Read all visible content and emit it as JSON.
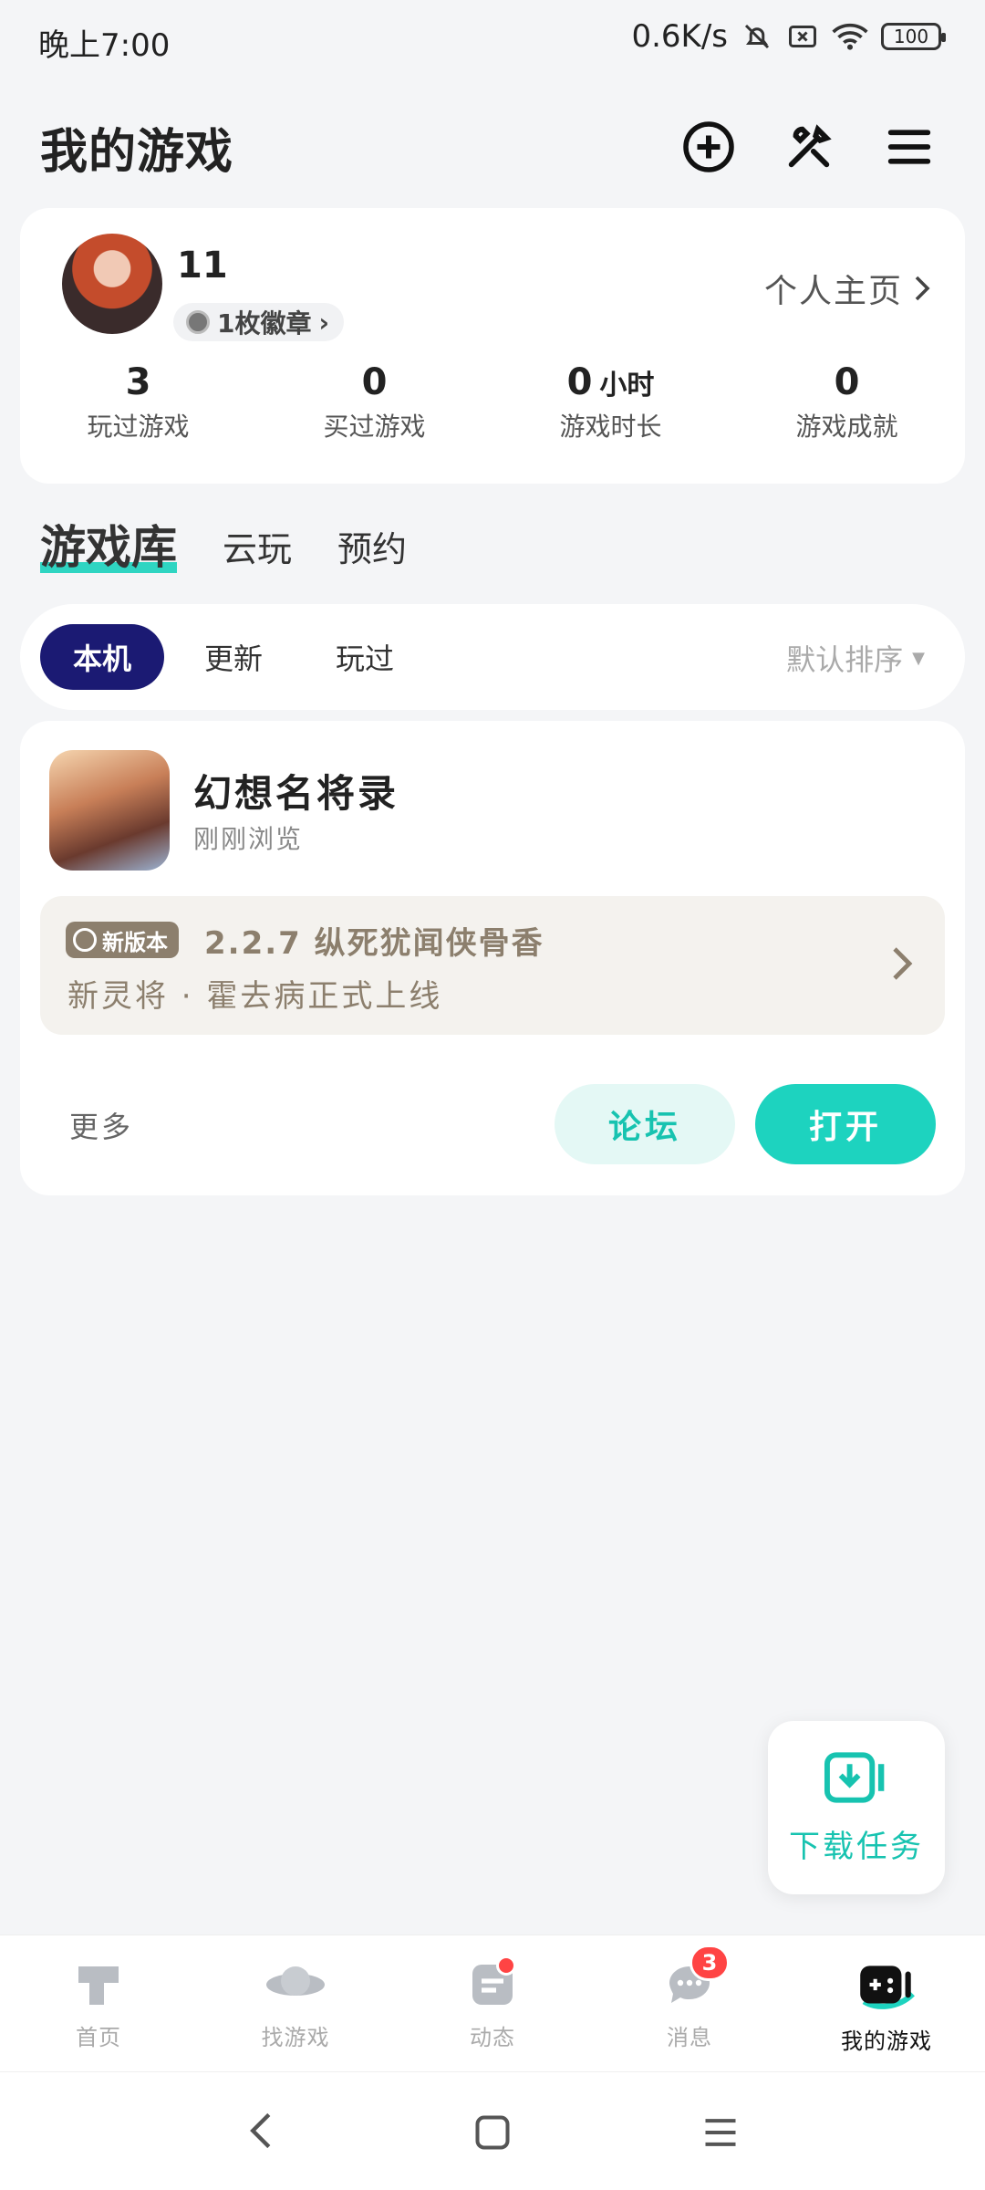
{
  "status": {
    "time": "晚上7:00",
    "speed": "0.6K/s",
    "battery": "100"
  },
  "header": {
    "title": "我的游戏"
  },
  "profile": {
    "username": "11",
    "badge": "1枚徽章",
    "home_link": "个人主页",
    "stats": [
      {
        "value": "3",
        "unit": "",
        "label": "玩过游戏"
      },
      {
        "value": "0",
        "unit": "",
        "label": "买过游戏"
      },
      {
        "value": "0",
        "unit": "小时",
        "label": "游戏时长"
      },
      {
        "value": "0",
        "unit": "",
        "label": "游戏成就"
      }
    ]
  },
  "category_tabs": [
    {
      "label": "游戏库"
    },
    {
      "label": "云玩"
    },
    {
      "label": "预约"
    }
  ],
  "filters": {
    "chips": [
      {
        "label": "本机"
      },
      {
        "label": "更新"
      },
      {
        "label": "玩过"
      }
    ],
    "sort": "默认排序"
  },
  "game": {
    "title": "幻想名将录",
    "subtitle": "刚刚浏览",
    "update_badge": "新版本",
    "update_title": "2.2.7  纵死犹闻侠骨香",
    "update_desc": "新灵将 · 霍去病正式上线",
    "more": "更多",
    "forum": "论坛",
    "open": "打开"
  },
  "download": {
    "label": "下载任务"
  },
  "bottom_nav": [
    {
      "label": "首页"
    },
    {
      "label": "找游戏"
    },
    {
      "label": "动态"
    },
    {
      "label": "消息",
      "badge": "3"
    },
    {
      "label": "我的游戏"
    }
  ],
  "colors": {
    "accent": "#1dd3bf",
    "chip_active": "#1b1a73",
    "badge_red": "#ff4444"
  }
}
